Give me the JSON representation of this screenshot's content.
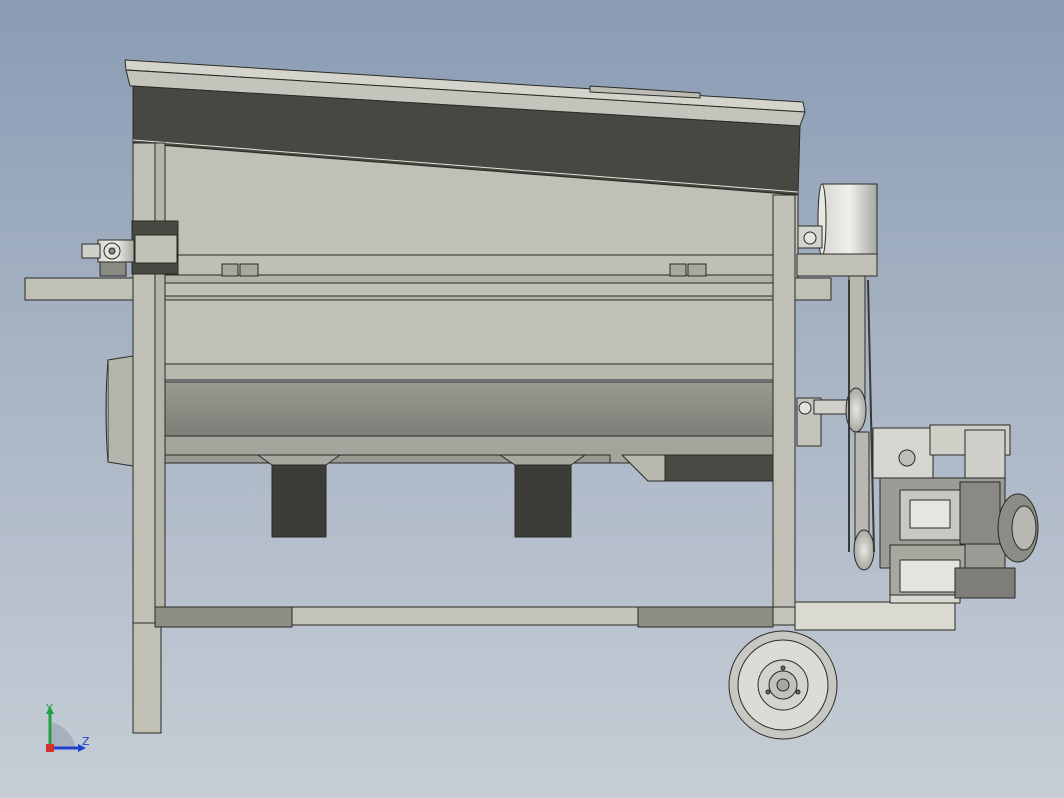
{
  "view": {
    "colors": {
      "background_top": "#8a9bb4",
      "background_bottom": "#c6cdd6",
      "body_panel": "#c0c0b6",
      "body_panel_shadow": "#a8a89e",
      "dark_panel": "#484842",
      "outline": "#2a2a26",
      "triad_x": "#d03030",
      "triad_y": "#20a040",
      "triad_z": "#2040d0"
    }
  },
  "triad": {
    "y_label": "Y",
    "z_label": "Z"
  }
}
